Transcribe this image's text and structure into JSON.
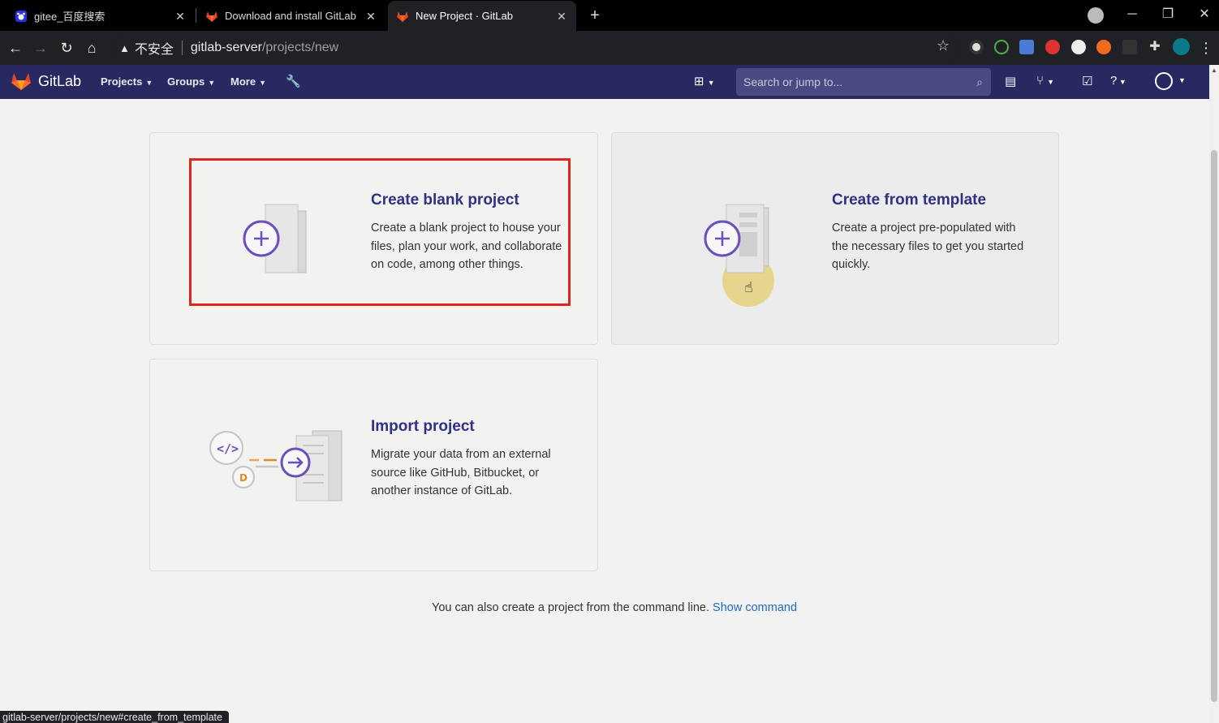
{
  "browser": {
    "tabs": [
      {
        "title": "gitee_百度搜索",
        "icon": "baidu-icon"
      },
      {
        "title": "Download and install GitLab | G",
        "icon": "gitlab-icon"
      },
      {
        "title": "New Project · GitLab",
        "icon": "gitlab-icon",
        "active": true
      }
    ],
    "address": {
      "security_label": "不安全",
      "host": "gitlab-server",
      "path": "/projects/new"
    },
    "status_url": "gitlab-server/projects/new#create_from_template"
  },
  "gitlab_nav": {
    "brand": "GitLab",
    "menus": [
      "Projects",
      "Groups",
      "More"
    ],
    "search_placeholder": "Search or jump to..."
  },
  "cards": {
    "blank": {
      "title": "Create blank project",
      "description": "Create a blank project to house your files, plan your work, and collaborate on code, among other things."
    },
    "template": {
      "title": "Create from template",
      "description": "Create a project pre-populated with the necessary files to get you started quickly."
    },
    "import": {
      "title": "Import project",
      "description": "Migrate your data from an external source like GitHub, Bitbucket, or another instance of GitLab."
    }
  },
  "footer": {
    "command_text": "You can also create a project from the command line.",
    "command_link": "Show command"
  },
  "colors": {
    "navbar": "#292961",
    "heading": "#303085",
    "link": "#1f6bbf",
    "highlight": "#e0241e",
    "accent_purple": "#6b4fbb"
  }
}
